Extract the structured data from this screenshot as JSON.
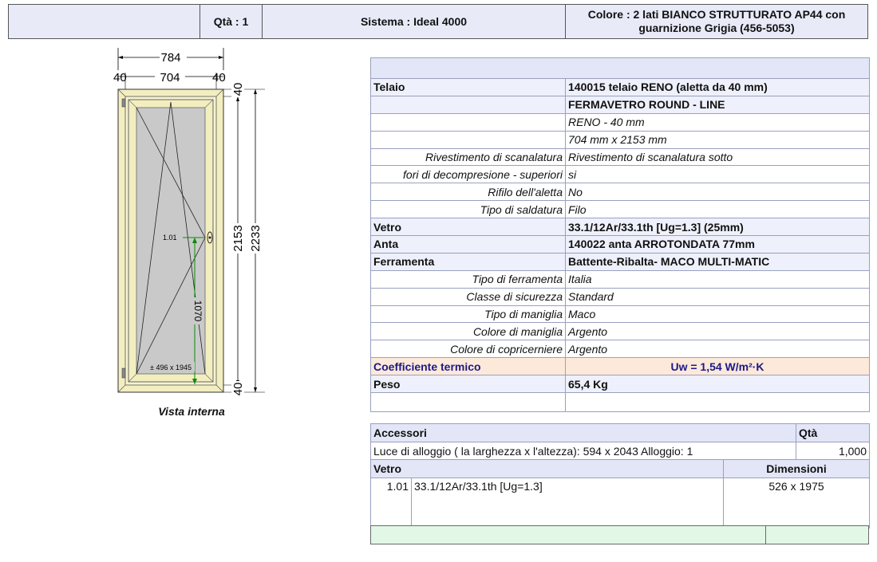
{
  "header": {
    "qty": "Qtà : 1",
    "sistema": "Sistema : Ideal 4000",
    "colore_line1": "Colore : 2 lati  BIANCO STRUTTURATO AP44 con",
    "colore_line2": "guarnizione Grigia (456-5053)"
  },
  "drawing": {
    "caption": "Vista interna",
    "dim_total_width": "784",
    "dim_left": "40",
    "dim_inner_width": "704",
    "dim_right": "40",
    "dim_top": "40",
    "dim_bottom": "40",
    "dim_inner_height": "2153",
    "dim_total_height": "2233",
    "glass_label": "1.01",
    "handle_height": "1070",
    "sash_size": "± 496 x 1945"
  },
  "spec": {
    "rows": [
      {
        "label": "Telaio",
        "value": "140015 telaio RENO (aletta da 40 mm)",
        "style": "main"
      },
      {
        "label": "",
        "value": "FERMAVETRO ROUND - LINE",
        "style": "main"
      },
      {
        "label": "",
        "value": "RENO -  40 mm",
        "style": "sub"
      },
      {
        "label": "",
        "value": "704 mm x 2153 mm",
        "style": "sub"
      },
      {
        "label": "Rivestimento di scanalatura",
        "value": "Rivestimento di scanalatura sotto",
        "style": "sub"
      },
      {
        "label": "fori di decompresione - superiori",
        "value": "si",
        "style": "sub"
      },
      {
        "label": "Rifilo dell'aletta",
        "value": "No",
        "style": "sub"
      },
      {
        "label": "Tipo di saldatura",
        "value": "Filo",
        "style": "sub"
      },
      {
        "label": "Vetro",
        "value": "33.1/12Ar/33.1th [Ug=1.3] (25mm)",
        "style": "main"
      },
      {
        "label": "Anta",
        "value": "140022 anta ARROTONDATA 77mm",
        "style": "main"
      },
      {
        "label": "Ferramenta",
        "value": "Battente-Ribalta- MACO MULTI-MATIC",
        "style": "main"
      },
      {
        "label": "Tipo di ferramenta",
        "value": "Italia",
        "style": "sub"
      },
      {
        "label": "Classe di sicurezza",
        "value": "Standard",
        "style": "sub"
      },
      {
        "label": "Tipo di maniglia",
        "value": "Maco",
        "style": "sub"
      },
      {
        "label": "Colore di maniglia",
        "value": "Argento",
        "style": "sub"
      },
      {
        "label": "Colore di copricerniere",
        "value": "Argento",
        "style": "sub"
      }
    ],
    "coef_label": "Coefficiente termico",
    "coef_value": "Uw = 1,54 W/m²·K",
    "peso_label": "Peso",
    "peso_value": "65,4 Kg"
  },
  "accessori": {
    "header": "Accessori",
    "qty_header": "Qtà",
    "row_text": "Luce di alloggio ( la larghezza x l'altezza): 594 x 2043  Alloggio: 1",
    "row_qty": "1,000"
  },
  "vetro_list": {
    "header": "Vetro",
    "dim_header": "Dimensioni",
    "row_idx": "1.01",
    "row_desc": "33.1/12Ar/33.1th [Ug=1.3]",
    "row_dim": "526 x 1975"
  }
}
